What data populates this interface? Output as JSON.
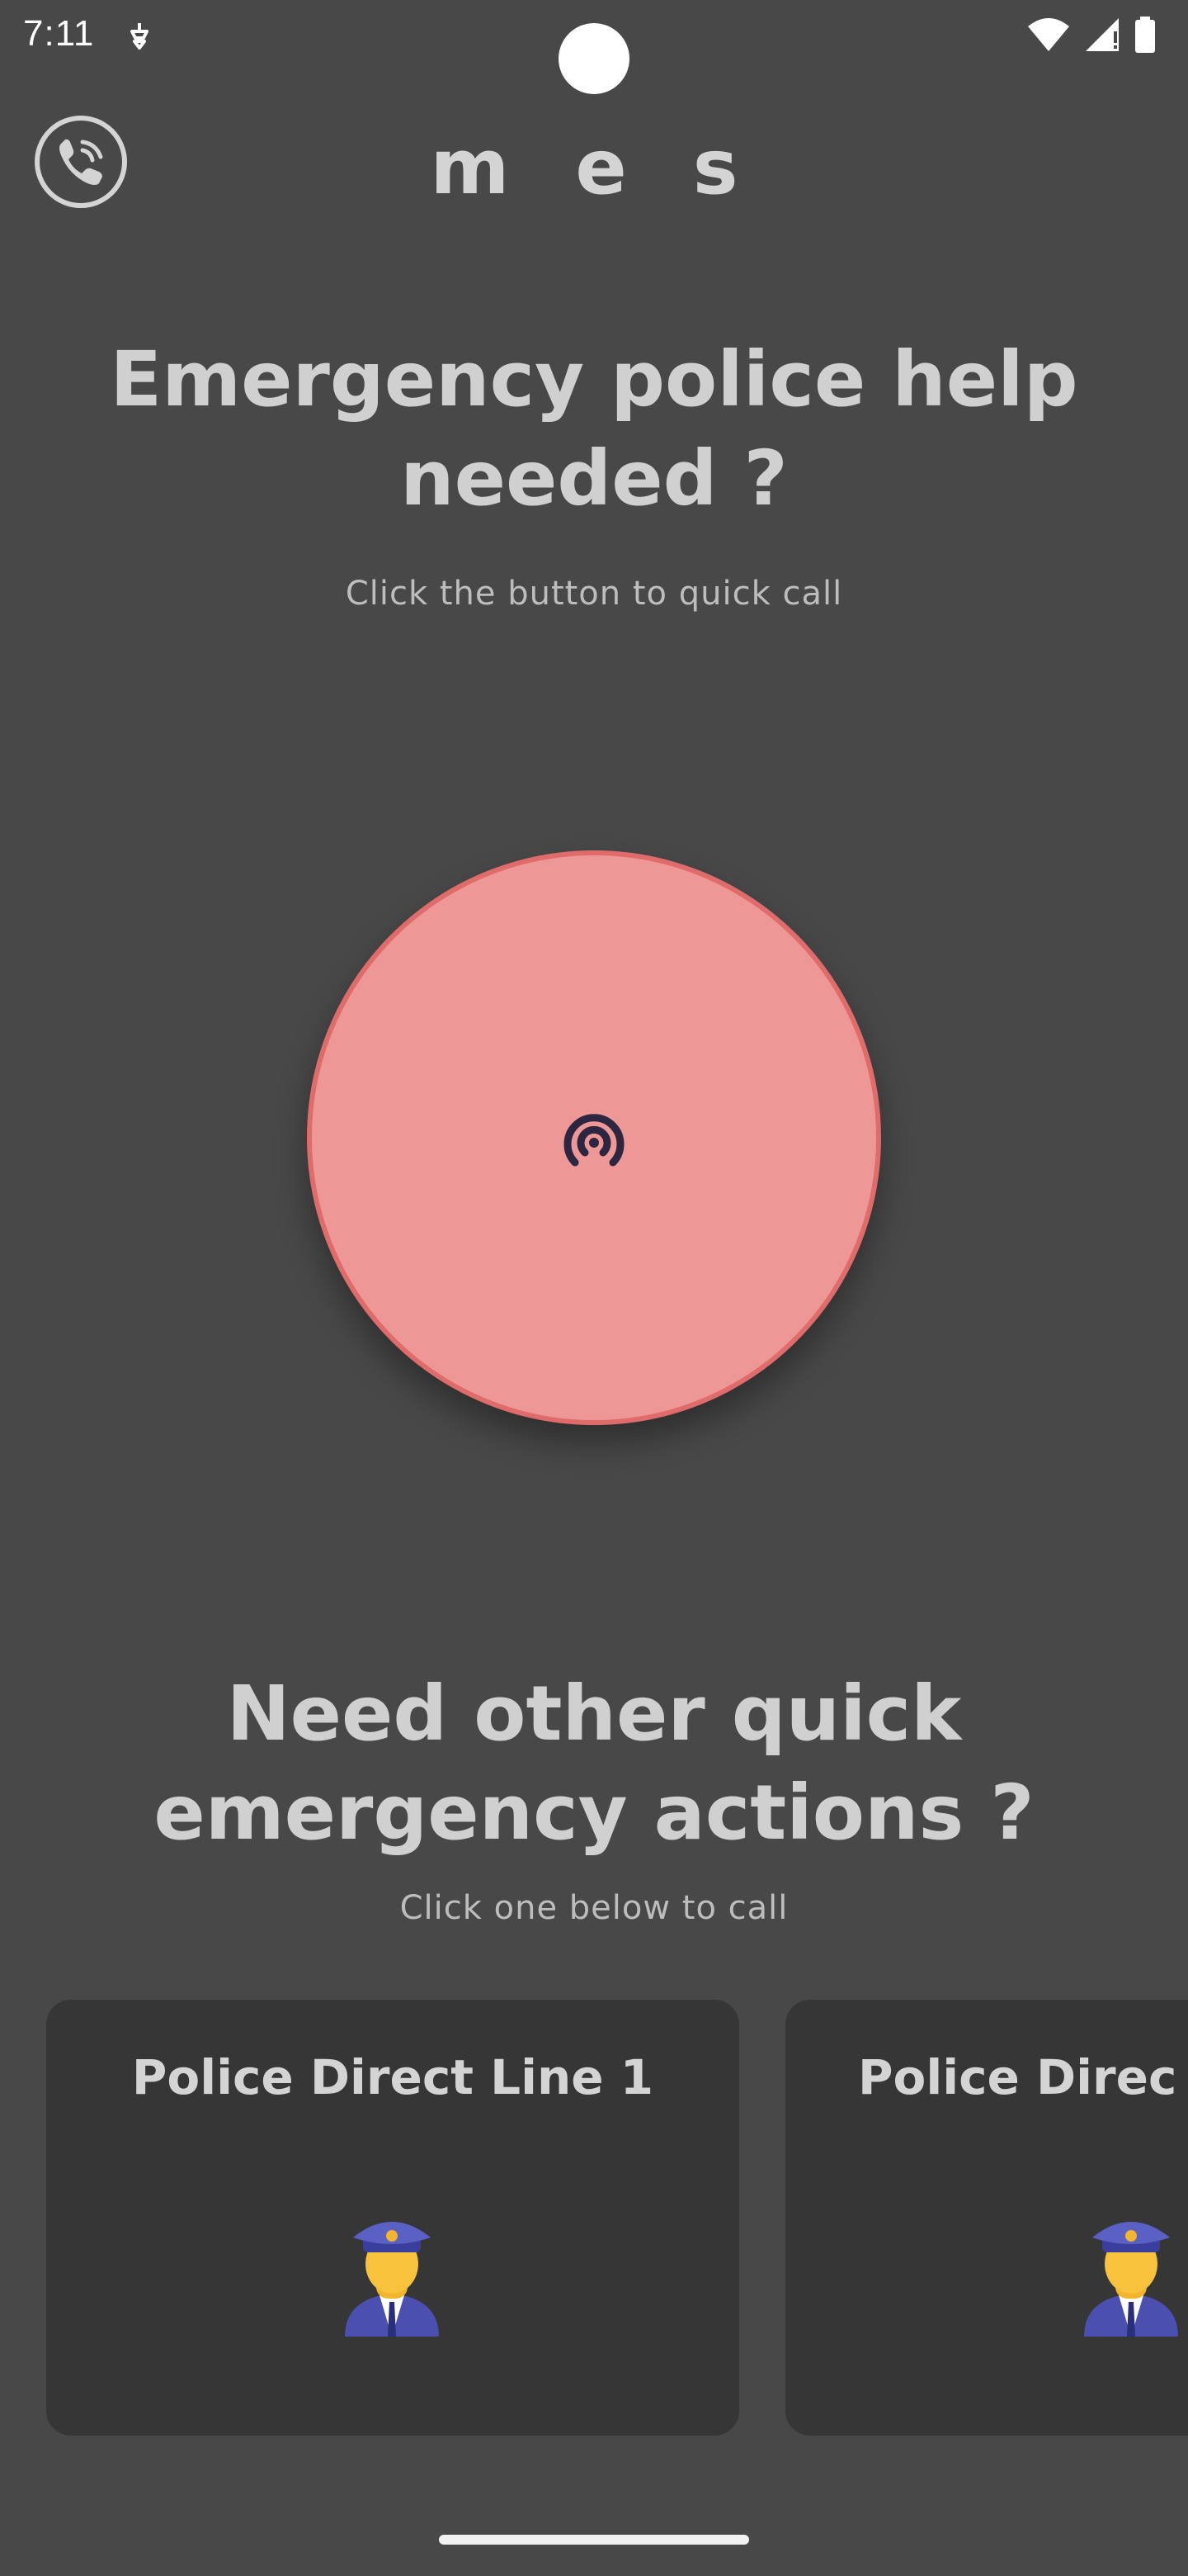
{
  "status_bar": {
    "time": "7:11",
    "icons": [
      "notification-icon",
      "wifi-icon",
      "signal-icon",
      "battery-icon"
    ]
  },
  "app_bar": {
    "logo_icon": "phone-call-icon",
    "title": "m e s"
  },
  "hero": {
    "headline": "Emergency police help needed ?",
    "subtext": "Click the button to quick call",
    "button_icon": "broadcast-icon",
    "button_color": "#ee9797",
    "button_border_color": "#e06b6b"
  },
  "quick_actions": {
    "headline": "Need other quick emergency actions ?",
    "subtext": "Click one below to call",
    "cards": [
      {
        "title": "Police Direct Line 1",
        "icon": "police-officer-icon"
      },
      {
        "title": "Police Direc",
        "icon": "police-officer-icon"
      }
    ]
  },
  "colors": {
    "background": "#484848",
    "card_background": "#363636",
    "text_primary": "#d4d4d4"
  }
}
